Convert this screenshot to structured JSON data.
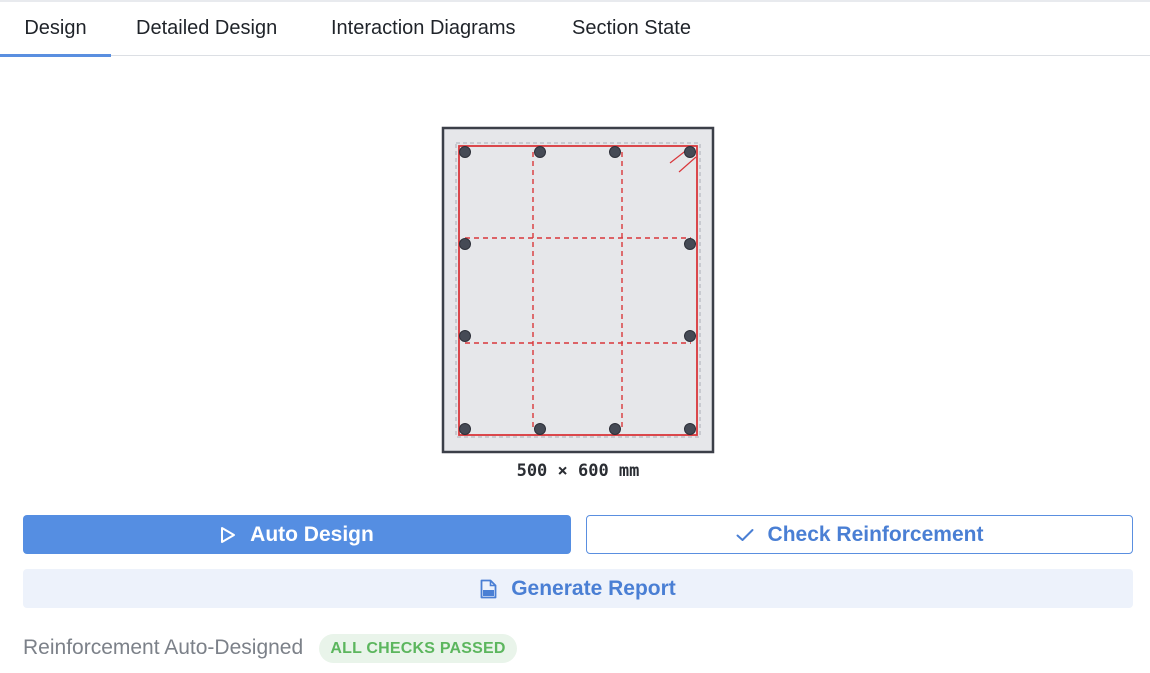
{
  "tabs": [
    {
      "label": "Design",
      "active": true
    },
    {
      "label": "Detailed Design",
      "active": false
    },
    {
      "label": "Interaction Diagrams",
      "active": false
    },
    {
      "label": "Section State",
      "active": false
    }
  ],
  "section": {
    "dimension_label": "500 × 600 mm",
    "bar_count": 12
  },
  "actions": {
    "auto_design": {
      "label": "Auto Design",
      "icon": "play-outline-icon"
    },
    "check_reinforcement": {
      "label": "Check Reinforcement",
      "icon": "checkmark-icon"
    },
    "generate_report": {
      "label": "Generate Report",
      "icon": "pdf-file-icon"
    }
  },
  "status": {
    "text": "Reinforcement Auto-Designed",
    "badge": "ALL CHECKS PASSED"
  },
  "colors": {
    "accent": "#558ee2",
    "concrete_fill": "#e6e7ea",
    "stirrup": "#d9373b",
    "bar": "#454a55",
    "success_bg": "#e9f4ea",
    "success_text": "#5cb65e"
  }
}
